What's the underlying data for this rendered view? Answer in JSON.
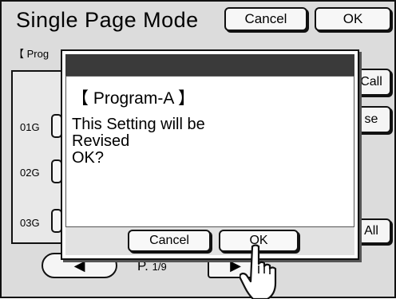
{
  "header": {
    "title": "Single Page Mode",
    "cancel_label": "Cancel",
    "ok_label": "OK"
  },
  "background": {
    "program_label": "【 Prog",
    "rows": [
      {
        "label": "01G"
      },
      {
        "label": "02G"
      },
      {
        "label": "03G"
      }
    ],
    "call_label": "Call",
    "erase_label": "se",
    "all_label": "All",
    "nav_prev_label": "◀",
    "nav_next_label": "▶",
    "page_prefix": "P.",
    "page_value": "1/9"
  },
  "dialog": {
    "title": "【 Program-A 】",
    "message": "This Setting will be\nRevised\nOK?",
    "cancel_label": "Cancel",
    "ok_label": "OK"
  },
  "icons": {
    "pointer": "pointing-hand-icon"
  }
}
